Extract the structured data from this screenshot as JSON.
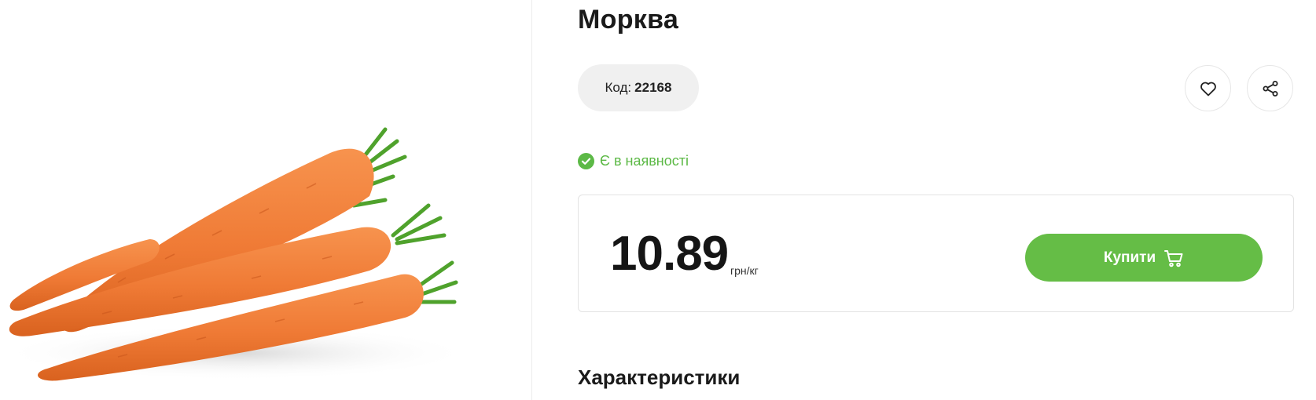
{
  "product": {
    "title": "Морква",
    "code_label": "Код:",
    "code_value": "22168",
    "image_subject": "carrots"
  },
  "actions": {
    "favorite_icon": "heart-icon",
    "share_icon": "share-icon"
  },
  "availability": {
    "text": "Є в наявності",
    "icon": "check-circle-icon"
  },
  "price": {
    "value": "10.89",
    "unit": "грн/кг",
    "buy_label": "Купити",
    "buy_icon": "cart-icon"
  },
  "sections": {
    "characteristics_title": "Характеристики"
  },
  "colors": {
    "accent_green": "#65bd46",
    "stock_green": "#5cb946",
    "pill_bg": "#f0f0f0",
    "carrot_orange": "#ef7a35"
  }
}
